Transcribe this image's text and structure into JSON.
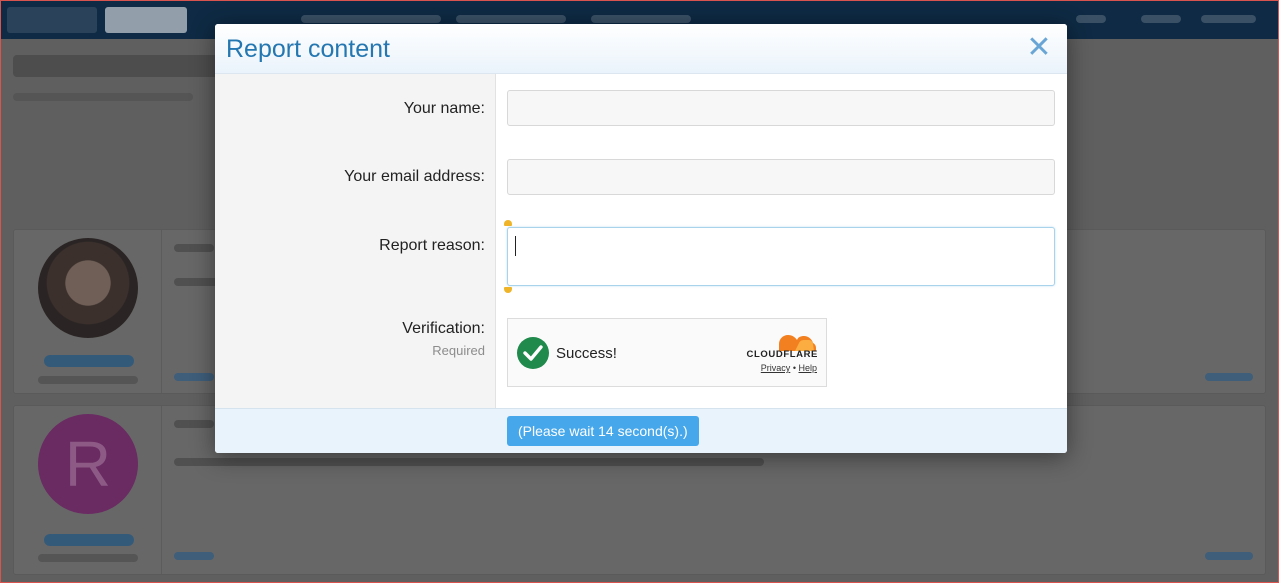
{
  "modal": {
    "title": "Report content",
    "close_glyph": "✕",
    "fields": {
      "name_label": "Your name:",
      "name_value": "",
      "email_label": "Your email address:",
      "email_value": "",
      "reason_label": "Report reason:",
      "reason_value": "",
      "verification_label": "Verification:",
      "verification_hint": "Required"
    },
    "captcha": {
      "status": "Success!",
      "brand": "CLOUDFLARE",
      "privacy_link": "Privacy",
      "separator": "•",
      "help_link": "Help"
    },
    "submit_label": "(Please wait 14 second(s).)"
  },
  "background": {
    "post2_avatar_letter": "R"
  },
  "colors": {
    "accent": "#2577b1",
    "button": "#47a7eb",
    "success": "#1f8a4c",
    "cloudflare_orange": "#f38020"
  },
  "icons": {
    "close": "close-icon",
    "success": "checkmark-icon",
    "brand": "cloudflare-cloud-icon"
  }
}
